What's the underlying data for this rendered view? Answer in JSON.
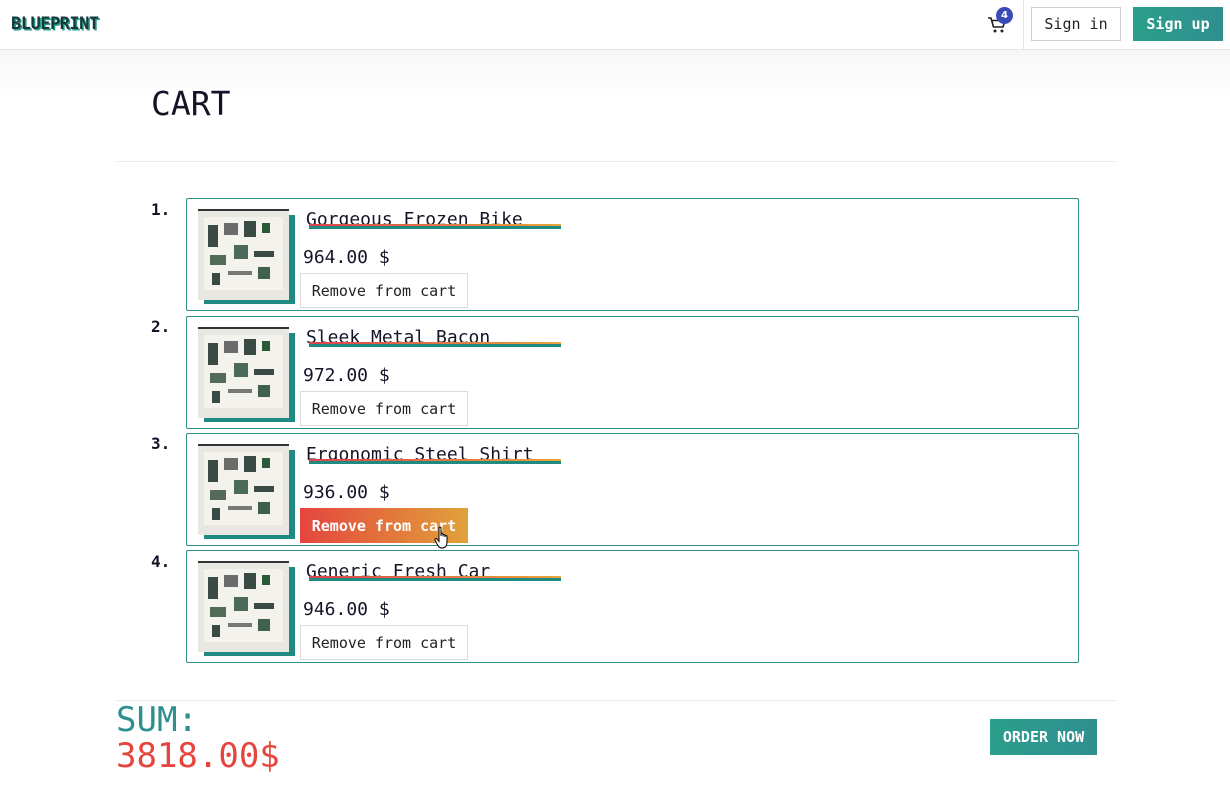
{
  "header": {
    "logo": "BLUEPRINT",
    "cart_count": "4",
    "cart_icon": "cart-icon",
    "signin_label": "Sign in",
    "signup_label": "Sign up"
  },
  "page": {
    "title": "CART"
  },
  "cart": {
    "items": [
      {
        "number": "1.",
        "name": "Gorgeous Frozen Bike",
        "price": "964.00 $",
        "remove_label": "Remove from cart"
      },
      {
        "number": "2.",
        "name": "Sleek Metal Bacon",
        "price": "972.00 $",
        "remove_label": "Remove from cart"
      },
      {
        "number": "3.",
        "name": "Ergonomic Steel Shirt",
        "price": "936.00 $",
        "remove_label": "Remove from cart"
      },
      {
        "number": "4.",
        "name": "Generic Fresh Car",
        "price": "946.00 $",
        "remove_label": "Remove from cart"
      }
    ]
  },
  "summary": {
    "sum_label": "SUM:",
    "sum_value": "3818.00$",
    "order_label": "ORDER NOW"
  },
  "colors": {
    "accent_teal": "#2f8f8f",
    "accent_red": "#e5453e",
    "accent_orange": "#e0a23a",
    "badge": "#3b4bb5"
  }
}
